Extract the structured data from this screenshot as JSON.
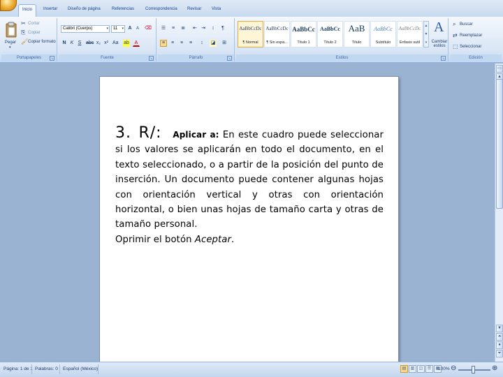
{
  "tabs": [
    "Inicio",
    "Insertar",
    "Diseño de página",
    "Referencias",
    "Correspondencia",
    "Revisar",
    "Vista"
  ],
  "clipboard": {
    "paste": "Pegar",
    "cut": "Cortar",
    "copy": "Copiar",
    "format_painter": "Copiar formato",
    "label": "Portapapeles"
  },
  "font": {
    "name": "Calibri (Cuerpo)",
    "size": "11",
    "label": "Fuente"
  },
  "paragraph": {
    "label": "Párrafo"
  },
  "styles": {
    "label": "Estilos",
    "items": [
      {
        "preview": "AaBbCcDc",
        "name": "¶ Normal"
      },
      {
        "preview": "AaBbCcDc",
        "name": "¶ Sin espa..."
      },
      {
        "preview": "AaBbCc",
        "name": "Título 1"
      },
      {
        "preview": "AaBbCc",
        "name": "Título 2"
      },
      {
        "preview": "AaB",
        "name": "Título"
      },
      {
        "preview": "AaBbCc",
        "name": "Subtítulo"
      },
      {
        "preview": "AaBbCcDc",
        "name": "Énfasis sutil"
      }
    ],
    "change_styles": "Cambiar estilos"
  },
  "editing": {
    "find": "Buscar",
    "replace": "Reemplazar",
    "select": "Seleccionar",
    "label": "Edición"
  },
  "document": {
    "number": "3.",
    "marker": "R/:",
    "lead": "Aplicar a:",
    "body": " En este cuadro puede seleccionar si los valores se aplicarán en todo el documento, en el texto seleccionado, o a partir de la posición del punto de inserción. Un documento puede contener algunas hojas con orientación vertical y otras con orientación horizontal, o bien unas hojas de tamaño carta y otras de tamaño personal.",
    "last_prefix": "Oprimir el botón ",
    "last_italic": "Aceptar",
    "last_suffix": "."
  },
  "status": {
    "pages": "Página: 1 de 1",
    "words": "Palabras: 0",
    "language": "Español (México)",
    "zoom": "100%",
    "zoom_fraction": 0.5
  },
  "colors": {
    "ribbon_accent": "#15428b",
    "background": "#9bb3d3",
    "selected_style": "#e9a73a"
  }
}
